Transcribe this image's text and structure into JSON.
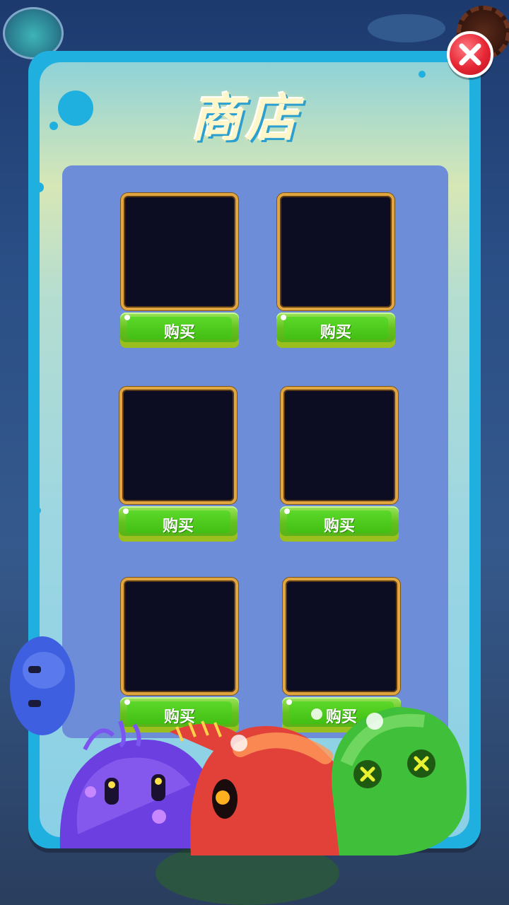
{
  "shop": {
    "title": "商店",
    "items": [
      {
        "buy_label": "购买"
      },
      {
        "buy_label": "购买"
      },
      {
        "buy_label": "购买"
      },
      {
        "buy_label": "购买"
      },
      {
        "buy_label": "购买"
      },
      {
        "buy_label": "购买"
      }
    ]
  },
  "icons": {
    "close": "close-icon",
    "settings": "gear-icon",
    "player_avatar": "slime-avatar-icon"
  },
  "colors": {
    "panel_border": "#1fb0e0",
    "grid_background": "#6e8dd8",
    "slot_frame": "#e2a640",
    "buy_button": "#54ab16",
    "close_button": "#e62634"
  }
}
